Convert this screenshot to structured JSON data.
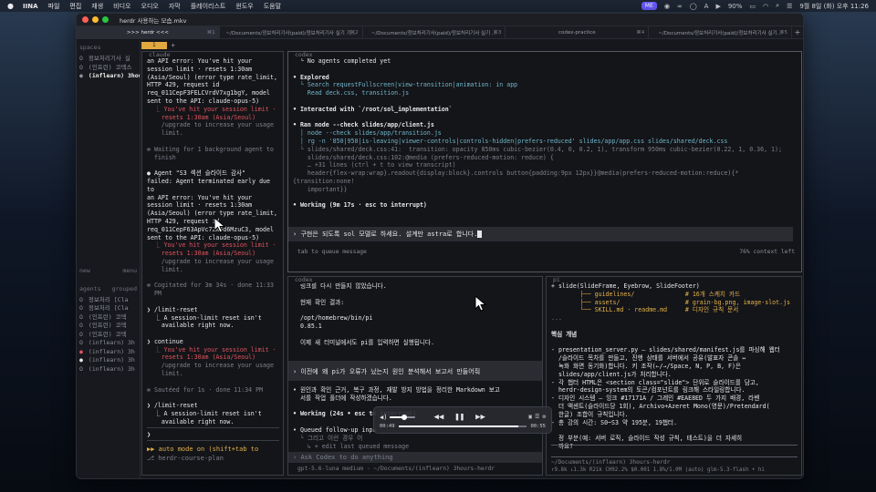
{
  "menubar": {
    "app": "IINA",
    "items": [
      "파일",
      "편집",
      "재생",
      "비디오",
      "오디오",
      "자막",
      "플레이리스트",
      "윈도우",
      "도움말"
    ],
    "battery": "90%",
    "clock": "9월 8일 (화) 오후 11:26",
    "badge": "ME"
  },
  "window": {
    "title": "herdr 사용하는 모습.mkv"
  },
  "tabs": [
    {
      "label": ">>> herdr <<<",
      "shortcut": "⌘1",
      "active": true
    },
    {
      "label": "~/Documents/정보처리기사(paid)/정보처리기사 실기 기...",
      "shortcut": "⌘2",
      "active": false
    },
    {
      "label": "~/Documents/정보처리기사(paid)/정보처리기사 실기 ...",
      "shortcut": "⌘3",
      "active": false
    },
    {
      "label": "codex-practice",
      "shortcut": "⌘4",
      "active": false
    },
    {
      "label": "~/Documents/정보처리기사(paid)/정보처리기사 실기...",
      "shortcut": "⌘5",
      "active": false
    }
  ],
  "sidebar": {
    "spaces_header": "spaces",
    "spaces": [
      {
        "marker": "O",
        "label": "정보처리기사 실",
        "active": false
      },
      {
        "marker": "O",
        "label": "(인프런) 코덱스",
        "active": false
      },
      {
        "marker": "●",
        "label": "(inflearn) 3hour",
        "active": true
      }
    ],
    "new_label": "new",
    "menu_label": "menu",
    "agents_header": "agents",
    "grouped_label": "grouped",
    "agents": [
      {
        "marker": "O",
        "label": "정보처리 [Cla",
        "tone": "muted"
      },
      {
        "marker": "O",
        "label": "정보처리 [Cla",
        "tone": "muted"
      },
      {
        "marker": "O",
        "label": "(인프런) 코덱",
        "tone": "muted"
      },
      {
        "marker": "O",
        "label": "(인프런) 코덱",
        "tone": "muted"
      },
      {
        "marker": "O",
        "label": "(인프런) 코덱",
        "tone": "muted"
      },
      {
        "marker": "O",
        "label": "(inflearn) 3h",
        "tone": "muted"
      },
      {
        "marker": "●",
        "label": "(inflearn) 3h",
        "tone": "red"
      },
      {
        "marker": "●",
        "label": "(inflearn) 3h",
        "tone": "white"
      },
      {
        "marker": "O",
        "label": "(inflearn) 3h",
        "tone": "muted"
      }
    ]
  },
  "pane_tab": {
    "number": "1",
    "add": "+"
  },
  "claude_pane": {
    "label": "claude",
    "lines": [
      {
        "text": "an API error: You've hit your\nsession limit · resets 1:30am\n(Asia/Seoul) (error type rate_limit,\nHTTP 429, request id\nreq_011CepF3FELCVrdV7xg1bgY, model\nsent to the API: claude-opus-5)",
        "cls": "c-white"
      },
      {
        "text": "  ⎿ You've hit your session limit ·\n    resets 1:30am (Asia/Seoul)",
        "cls": "c-red"
      },
      {
        "text": "    /upgrade to increase your usage\n    limit.",
        "cls": "c-muted"
      },
      {
        "text": " ",
        "cls": ""
      },
      {
        "text": "✻ Waiting for 1 background agent to\n  finish",
        "cls": "c-muted"
      },
      {
        "text": " ",
        "cls": ""
      },
      {
        "text": "● Agent \"S3 섹션 슬라이드 감사\"\nfailed: Agent terminated early due to\nan API error: You've hit your\nsession limit · resets 1:30am\n(Asia/Seoul) (error type rate_limit,\nHTTP 429, request id\nreq_011CepF63ApVc7ZN6d6MzuC3, model\nsent to the API: claude-opus-5)",
        "cls": "c-white"
      },
      {
        "text": "  ⎿ You've hit your session limit ·\n    resets 1:30am (Asia/Seoul)",
        "cls": "c-red"
      },
      {
        "text": "    /upgrade to increase your usage\n    limit.",
        "cls": "c-muted"
      },
      {
        "text": " ",
        "cls": ""
      },
      {
        "text": "✻ Cogitated for 3m 34s · done 11:33\n  PM",
        "cls": "c-muted"
      },
      {
        "text": " ",
        "cls": ""
      },
      {
        "text": "❯ /limit-reset",
        "cls": "c-white"
      },
      {
        "text": "  ⎿ A session-limit reset isn't\n    available right now.",
        "cls": "c-white"
      },
      {
        "text": " ",
        "cls": ""
      },
      {
        "text": "❯ continue",
        "cls": "c-white"
      },
      {
        "text": "  ⎿ You've hit your session limit ·\n    resets 1:30am (Asia/Seoul)",
        "cls": "c-red"
      },
      {
        "text": "    /upgrade to increase your usage\n    limit.",
        "cls": "c-muted"
      },
      {
        "text": " ",
        "cls": ""
      },
      {
        "text": "✻ Sautéed for 1s · done 11:34 PM",
        "cls": "c-muted"
      },
      {
        "text": " ",
        "cls": ""
      },
      {
        "text": "❯ /limit-reset",
        "cls": "c-white"
      },
      {
        "text": "  ⎿ A session-limit reset isn't\n    available right now.",
        "cls": "c-white"
      }
    ],
    "prompt": "❯",
    "footer_mode": "▶▶ auto mode on (shift+tab to",
    "footer_branch": "⎇ herdr-course-plan"
  },
  "codex_top": {
    "label": "codex",
    "lines": [
      {
        "text": "  └ No agents completed yet",
        "cls": "c-white"
      },
      {
        "text": " ",
        "cls": ""
      },
      {
        "text": "• Explored",
        "cls": "c-bold"
      },
      {
        "text": "  └ Search requestFullscreen|view-transition|animation: in app",
        "cls": "c-cyan"
      },
      {
        "text": "    Read deck.css, transition.js",
        "cls": "c-cyan"
      },
      {
        "text": " ",
        "cls": ""
      },
      {
        "text": "• Interacted with `/root/sol_implementation`",
        "cls": "c-bold"
      },
      {
        "text": " ",
        "cls": ""
      },
      {
        "text": "• Ran node --check slides/app/client.js",
        "cls": "c-bold"
      },
      {
        "text": "  │ node --check slides/app/transition.js",
        "cls": "c-cyan"
      },
      {
        "text": "  │ rg -n '850|950|is-leaving|viewer-controls|controls-hidden|prefers-reduced' slides/app/app.css slides/shared/deck.css",
        "cls": "c-cyan"
      },
      {
        "text": "  └ slides/shared/deck.css:41:  transition: opacity 850ms cubic-bezier(0.4, 0, 0.2, 1), transform 950ms cubic-bezier(0.22, 1, 0.36, 1);",
        "cls": "c-muted"
      },
      {
        "text": "    slides/shared/deck.css:102:@media (prefers-reduced-motion: reduce) {",
        "cls": "c-muted"
      },
      {
        "text": "    … +31 lines (ctrl + t to view transcript)",
        "cls": "c-muted"
      },
      {
        "text": "    header{flex-wrap:wrap}.readout{display:block}.controls button{padding:9px 12px}}@media(prefers-reduced-motion:reduce){*{transition:none!",
        "cls": "c-muted"
      },
      {
        "text": "    important}}",
        "cls": "c-muted"
      },
      {
        "text": " ",
        "cls": ""
      },
      {
        "text": "• Working (9m 17s · esc to interrupt)",
        "cls": "c-bold"
      },
      {
        "text": " ",
        "cls": ""
      }
    ],
    "input_prefix": "›",
    "input_text": "구현은 되도록 sol 모델로 하세요. 설계만 astra로 합니다.",
    "hint": "tab to queue message",
    "context": "76% context left"
  },
  "codex_bottom": {
    "label": "codex",
    "lines": [
      {
        "text": "  링크를 다시 만들지 않았습니다.",
        "cls": "c-white"
      },
      {
        "text": " ",
        "cls": ""
      },
      {
        "text": "  현재 확인 결과:",
        "cls": "c-white"
      },
      {
        "text": " ",
        "cls": ""
      },
      {
        "text": "  /opt/homebrew/bin/pi",
        "cls": "c-white"
      },
      {
        "text": "  0.85.1",
        "cls": "c-white"
      },
      {
        "text": " ",
        "cls": ""
      },
      {
        "text": "  이제 새 터미널에서도 pi를 입력하면 실행됩니다.",
        "cls": "c-white"
      },
      {
        "text": " ",
        "cls": ""
      },
      {
        "text": " ",
        "cls": ""
      }
    ],
    "user_msg": "› 이전에 왜 pi가 오류가 났는지 원인 분석해서 보고서 만들어줘",
    "lines2": [
      {
        "text": "• 원인과 확인 근거, 복구 과정, 재발 방지 방법을 정리한 Markdown 보고\n  서를 작업 폴더에 작성하겠습니다.",
        "cls": "c-white"
      },
      {
        "text": " ",
        "cls": ""
      },
      {
        "text": "• Working (24s • esc to interrupt)",
        "cls": "c-bold"
      },
      {
        "text": " ",
        "cls": ""
      },
      {
        "text": "• Queued follow-up inpu",
        "cls": "c-white"
      },
      {
        "text": "  └ 그리고 이런 경우 어",
        "cls": "c-muted"
      },
      {
        "text": "    ↳ + edit last queued message",
        "cls": "c-muted"
      }
    ],
    "input_prefix": "›",
    "input_placeholder": "Ask Codex to do anything",
    "status": "gpt-5.6-luna medium · ~/Documents/(inflearn) 3hours-herdr"
  },
  "pi_pane": {
    "label": "pi",
    "lines": [
      {
        "text": "+ slide(SlideFrame, Eyebrow, SlideFooter)",
        "cls": "c-white"
      },
      {
        "text": "        ├── guidelines/              # 16개 스케치 카드",
        "cls": "c-yellow"
      },
      {
        "text": "        ├── assets/                  # grain-bg.png, image-slot.js",
        "cls": "c-yellow"
      },
      {
        "text": "        └── SKILL.md · readme.md     # 디자인 규칙 문서",
        "cls": "c-yellow"
      },
      {
        "text": "...",
        "cls": "c-muted"
      },
      {
        "text": " ",
        "cls": ""
      },
      {
        "text": "핵심 개념",
        "cls": "c-bold"
      },
      {
        "text": " ",
        "cls": ""
      },
      {
        "text": "- presentation_server.py — slides/shared/manifest.js를 파싱해 웹터\n  /슬라이드 목차를 만들고, 진행 상태를 서버에서 공유(발표자 콘솔 ↔\n  녹화 화면 동기화)합니다. 키 조작(←/→/Space, N, P, B, F)은\n  slides/app/client.js가 처리합니다.",
        "cls": "c-white"
      },
      {
        "text": "- 각 챕터 HTML은 <section class=\"slide\"> 단위로 슬라이드를 담고,\n  herdr-design-system의 토큰/컴포넌트를 링크해 스타일링합니다.",
        "cls": "c-white"
      },
      {
        "text": "- 디자인 시스템 — 잉크 #17171A / 그레인 #EAE8ED 두 가지 배경, 라벤\n  더 액센트(슬라이드당 1회), Archivo+Azeret Mono(영문)/Pretendard(\n  한글) 조합이 규칙입니다.",
        "cls": "c-white"
      },
      {
        "text": "- 총 강의 시간: S0~S3 약 195분, 19챕터.",
        "cls": "c-white"
      },
      {
        "text": " ",
        "cls": ""
      },
      {
        "text": "  정 부분(예: 서버 로직, 슬라이드 작성 규칙, 테스트)을 더 자세히\n  까요?",
        "cls": "c-white"
      },
      {
        "text": " ",
        "cls": ""
      }
    ],
    "input_prefix": "",
    "path": "~/Documents/(inflearn) 3hours-herdr",
    "status": "↑9.8k ↓1.3k R21k CH92.2% $0.001 1.8%/1.0M (auto)  glm-5.3-flash • hi"
  },
  "media": {
    "elapsed": "00:49",
    "remaining": "00:55",
    "progress": 0.93,
    "volume": 0.55
  }
}
